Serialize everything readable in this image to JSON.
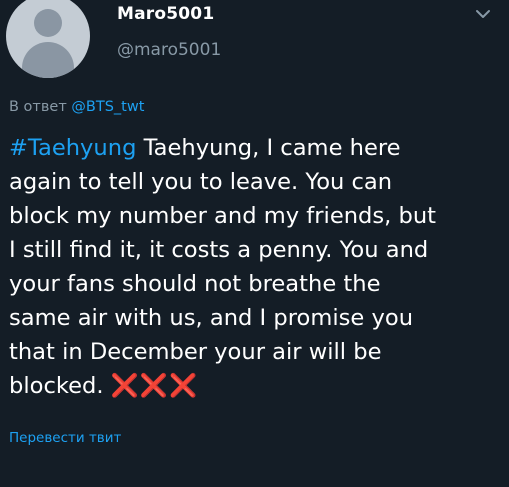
{
  "tweet": {
    "display_name": "Maro5001",
    "handle": "@maro5001",
    "reply_prefix": "В ответ ",
    "reply_mention": "@BTS_twt",
    "hashtag": "#Taehyung",
    "lines": [
      " Taehyung, I came here",
      "again to tell you to leave.  You can",
      "block my number and my friends, but",
      "I still find it, it costs a penny.  You and",
      "your fans should not breathe the",
      "same air with us, and I promise you",
      "that in December your air will be",
      "blocked. "
    ],
    "emoji": "❌❌❌",
    "translate_label": "Перевести твит"
  },
  "colors": {
    "background": "#141d26",
    "link_blue": "#1da1f2",
    "muted_gray": "#8899a6",
    "x_red": "#e0245e"
  },
  "icons": {
    "avatar": "default-profile-icon",
    "caret": "chevron-down-icon"
  }
}
